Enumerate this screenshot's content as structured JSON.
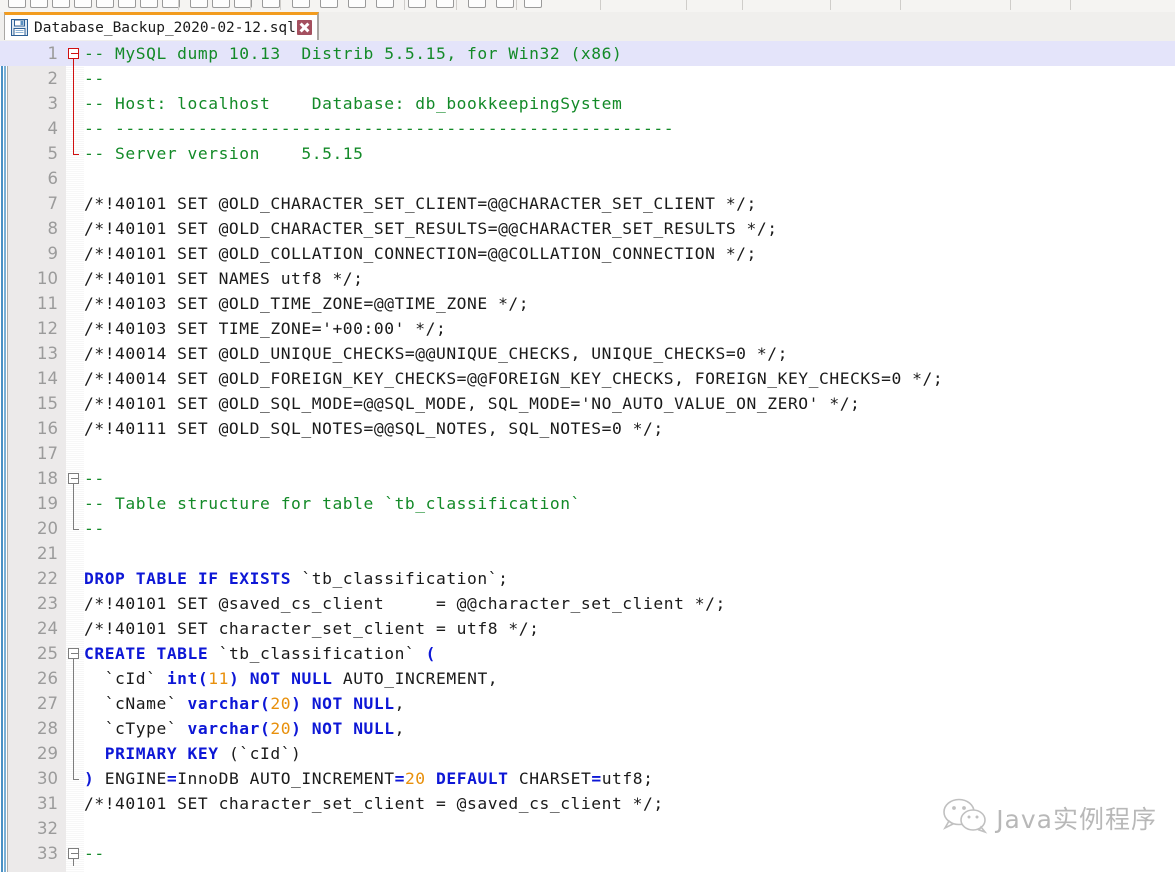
{
  "window": {
    "app_hint": "code-editor"
  },
  "toolbar": {
    "icons": [
      "new-file-icon",
      "open-folder-icon",
      "save-icon",
      "save-all-icon",
      "close-icon",
      "close-all-icon",
      "print-icon",
      "cut-icon",
      "copy-icon",
      "paste-icon",
      "undo-icon",
      "redo-icon",
      "search-icon",
      "replace-icon",
      "zoom-in-icon",
      "zoom-out-icon",
      "sync-scroll-icon",
      "word-wrap-icon",
      "show-all-chars-icon",
      "indent-guide-icon",
      "record-macro-icon"
    ]
  },
  "tabs": [
    {
      "icon": "floppy-disk-icon",
      "label": "Database_Backup_2020-02-12.sql",
      "close_label": "×",
      "active": true
    }
  ],
  "editor": {
    "current_line": 1,
    "colors": {
      "comment": "#138a28",
      "keyword": "#0d17d6",
      "number": "#e8900c",
      "text": "#1a1a1a",
      "current_line_bg": "#e4e4fa",
      "gutter_bg": "#eceaea",
      "line_number": "#9b9b9b",
      "tab_accent": "#f29c1f",
      "tab_close_bg": "#a4505f"
    },
    "lines": [
      {
        "n": 1,
        "fold": "start-red",
        "tokens": [
          {
            "t": "-- MySQL dump 10.13  Distrib 5.5.15, for Win32 (x86)",
            "c": "cm"
          }
        ]
      },
      {
        "n": 2,
        "fold": "bar-red",
        "tokens": [
          {
            "t": "--",
            "c": "cm"
          }
        ]
      },
      {
        "n": 3,
        "fold": "bar-red",
        "tokens": [
          {
            "t": "-- Host: localhost    Database: db_bookkeepingSystem",
            "c": "cm"
          }
        ]
      },
      {
        "n": 4,
        "fold": "bar-red",
        "tokens": [
          {
            "t": "-- ------------------------------------------------------",
            "c": "cm"
          }
        ]
      },
      {
        "n": 5,
        "fold": "end-red",
        "tokens": [
          {
            "t": "-- Server version\t5.5.15",
            "c": "cm"
          }
        ]
      },
      {
        "n": 6,
        "fold": "",
        "tokens": []
      },
      {
        "n": 7,
        "fold": "",
        "tokens": [
          {
            "t": "/*!40101 SET @OLD_CHARACTER_SET_CLIENT=@@CHARACTER_SET_CLIENT */;",
            "c": ""
          }
        ]
      },
      {
        "n": 8,
        "fold": "",
        "tokens": [
          {
            "t": "/*!40101 SET @OLD_CHARACTER_SET_RESULTS=@@CHARACTER_SET_RESULTS */;",
            "c": ""
          }
        ]
      },
      {
        "n": 9,
        "fold": "",
        "tokens": [
          {
            "t": "/*!40101 SET @OLD_COLLATION_CONNECTION=@@COLLATION_CONNECTION */;",
            "c": ""
          }
        ]
      },
      {
        "n": 10,
        "fold": "",
        "tokens": [
          {
            "t": "/*!40101 SET NAMES utf8 */;",
            "c": ""
          }
        ]
      },
      {
        "n": 11,
        "fold": "",
        "tokens": [
          {
            "t": "/*!40103 SET @OLD_TIME_ZONE=@@TIME_ZONE */;",
            "c": ""
          }
        ]
      },
      {
        "n": 12,
        "fold": "",
        "tokens": [
          {
            "t": "/*!40103 SET TIME_ZONE='+00:00' */;",
            "c": ""
          }
        ]
      },
      {
        "n": 13,
        "fold": "",
        "tokens": [
          {
            "t": "/*!40014 SET @OLD_UNIQUE_CHECKS=@@UNIQUE_CHECKS, UNIQUE_CHECKS=0 */;",
            "c": ""
          }
        ]
      },
      {
        "n": 14,
        "fold": "",
        "tokens": [
          {
            "t": "/*!40014 SET @OLD_FOREIGN_KEY_CHECKS=@@FOREIGN_KEY_CHECKS, FOREIGN_KEY_CHECKS=0 */;",
            "c": ""
          }
        ]
      },
      {
        "n": 15,
        "fold": "",
        "tokens": [
          {
            "t": "/*!40101 SET @OLD_SQL_MODE=@@SQL_MODE, SQL_MODE='NO_AUTO_VALUE_ON_ZERO' */;",
            "c": ""
          }
        ]
      },
      {
        "n": 16,
        "fold": "",
        "tokens": [
          {
            "t": "/*!40111 SET @OLD_SQL_NOTES=@@SQL_NOTES, SQL_NOTES=0 */;",
            "c": ""
          }
        ]
      },
      {
        "n": 17,
        "fold": "",
        "tokens": []
      },
      {
        "n": 18,
        "fold": "start-gry",
        "tokens": [
          {
            "t": "--",
            "c": "cm"
          }
        ]
      },
      {
        "n": 19,
        "fold": "bar-gry",
        "tokens": [
          {
            "t": "-- Table structure for table `tb_classification`",
            "c": "cm"
          }
        ]
      },
      {
        "n": 20,
        "fold": "end-gry",
        "tokens": [
          {
            "t": "--",
            "c": "cm"
          }
        ]
      },
      {
        "n": 21,
        "fold": "",
        "tokens": []
      },
      {
        "n": 22,
        "fold": "",
        "tokens": [
          {
            "t": "DROP TABLE IF EXISTS",
            "c": "kw"
          },
          {
            "t": " `tb_classification`;",
            "c": ""
          }
        ]
      },
      {
        "n": 23,
        "fold": "",
        "tokens": [
          {
            "t": "/*!40101 SET @saved_cs_client     = @@character_set_client */;",
            "c": ""
          }
        ]
      },
      {
        "n": 24,
        "fold": "",
        "tokens": [
          {
            "t": "/*!40101 SET character_set_client = utf8 */;",
            "c": ""
          }
        ]
      },
      {
        "n": 25,
        "fold": "start-gry",
        "tokens": [
          {
            "t": "CREATE TABLE",
            "c": "kw"
          },
          {
            "t": " `tb_classification` ",
            "c": ""
          },
          {
            "t": "(",
            "c": "kw"
          }
        ]
      },
      {
        "n": 26,
        "fold": "bar-gry",
        "tokens": [
          {
            "t": "  `cId` ",
            "c": ""
          },
          {
            "t": "int",
            "c": "kw"
          },
          {
            "t": "(",
            "c": "kw"
          },
          {
            "t": "11",
            "c": "nu"
          },
          {
            "t": ")",
            "c": "kw"
          },
          {
            "t": " ",
            "c": ""
          },
          {
            "t": "NOT NULL",
            "c": "kw"
          },
          {
            "t": " AUTO_INCREMENT,",
            "c": ""
          }
        ]
      },
      {
        "n": 27,
        "fold": "bar-gry",
        "tokens": [
          {
            "t": "  `cName` ",
            "c": ""
          },
          {
            "t": "varchar",
            "c": "kw"
          },
          {
            "t": "(",
            "c": "kw"
          },
          {
            "t": "20",
            "c": "nu"
          },
          {
            "t": ")",
            "c": "kw"
          },
          {
            "t": " ",
            "c": ""
          },
          {
            "t": "NOT NULL",
            "c": "kw"
          },
          {
            "t": ",",
            "c": ""
          }
        ]
      },
      {
        "n": 28,
        "fold": "bar-gry",
        "tokens": [
          {
            "t": "  `cType` ",
            "c": ""
          },
          {
            "t": "varchar",
            "c": "kw"
          },
          {
            "t": "(",
            "c": "kw"
          },
          {
            "t": "20",
            "c": "nu"
          },
          {
            "t": ")",
            "c": "kw"
          },
          {
            "t": " ",
            "c": ""
          },
          {
            "t": "NOT NULL",
            "c": "kw"
          },
          {
            "t": ",",
            "c": ""
          }
        ]
      },
      {
        "n": 29,
        "fold": "bar-gry",
        "tokens": [
          {
            "t": "  ",
            "c": ""
          },
          {
            "t": "PRIMARY KEY",
            "c": "kw"
          },
          {
            "t": " (`cId`)",
            "c": ""
          }
        ]
      },
      {
        "n": 30,
        "fold": "end-gry",
        "tokens": [
          {
            "t": ")",
            "c": "kw"
          },
          {
            "t": " ENGINE",
            "c": ""
          },
          {
            "t": "=",
            "c": "op"
          },
          {
            "t": "InnoDB AUTO_INCREMENT",
            "c": ""
          },
          {
            "t": "=",
            "c": "op"
          },
          {
            "t": "20",
            "c": "nu"
          },
          {
            "t": " ",
            "c": ""
          },
          {
            "t": "DEFAULT",
            "c": "kw"
          },
          {
            "t": " CHARSET",
            "c": ""
          },
          {
            "t": "=",
            "c": "op"
          },
          {
            "t": "utf8;",
            "c": ""
          }
        ]
      },
      {
        "n": 31,
        "fold": "",
        "tokens": [
          {
            "t": "/*!40101 SET character_set_client = @saved_cs_client */;",
            "c": ""
          }
        ]
      },
      {
        "n": 32,
        "fold": "",
        "tokens": []
      },
      {
        "n": 33,
        "fold": "start-gry",
        "tokens": [
          {
            "t": "--",
            "c": "cm"
          }
        ]
      }
    ]
  },
  "watermark": {
    "icon": "wechat-icon",
    "text": "Java实例程序"
  }
}
